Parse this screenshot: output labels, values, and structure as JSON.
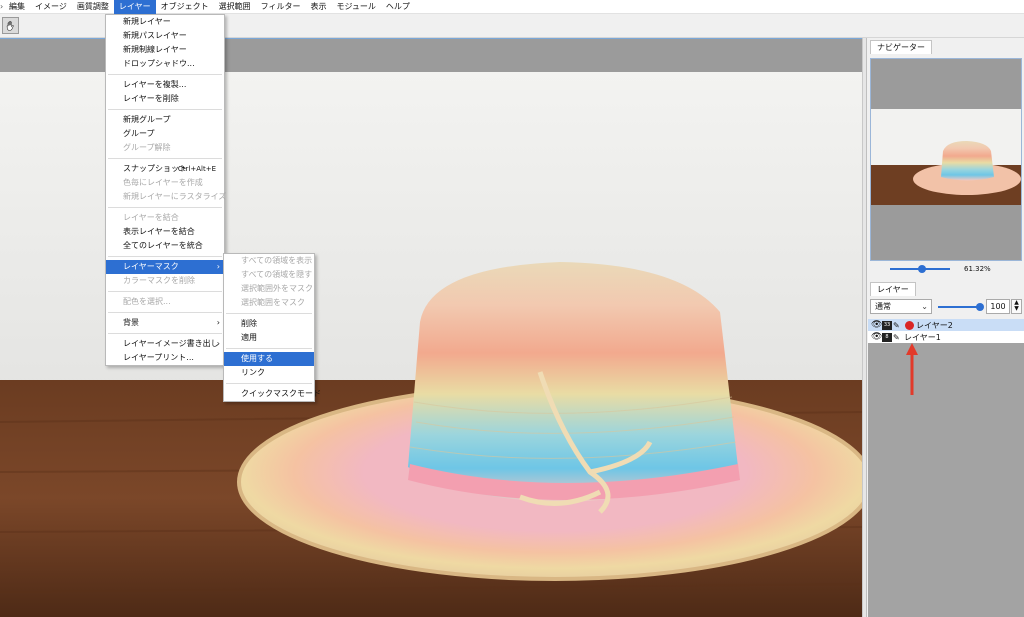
{
  "menubar": {
    "items": [
      "編集",
      "イメージ",
      "画質調整",
      "レイヤー",
      "オブジェクト",
      "選択範囲",
      "フィルター",
      "表示",
      "モジュール",
      "ヘルプ"
    ],
    "active_index": 3
  },
  "toolbar": {
    "tool_icon": "hand-icon"
  },
  "layer_menu": {
    "items": [
      {
        "label": "新規レイヤー",
        "disabled": false
      },
      {
        "label": "新規パスレイヤー",
        "disabled": false
      },
      {
        "label": "新規制線レイヤー",
        "disabled": false
      },
      {
        "label": "ドロップシャドウ...",
        "disabled": false
      },
      {
        "sep": true
      },
      {
        "label": "レイヤーを複製...",
        "disabled": false
      },
      {
        "label": "レイヤーを削除",
        "disabled": false
      },
      {
        "sep": true
      },
      {
        "label": "新規グループ",
        "disabled": false
      },
      {
        "label": "グループ",
        "disabled": false
      },
      {
        "label": "グループ解除",
        "disabled": true
      },
      {
        "sep": true
      },
      {
        "label": "スナップショット",
        "shortcut": "Ctrl+Alt+E",
        "disabled": false
      },
      {
        "label": "色毎にレイヤーを作成",
        "disabled": true
      },
      {
        "label": "新規レイヤーにラスタライズ",
        "disabled": true
      },
      {
        "sep": true
      },
      {
        "label": "レイヤーを結合",
        "disabled": true
      },
      {
        "label": "表示レイヤーを結合",
        "disabled": false
      },
      {
        "label": "全てのレイヤーを統合",
        "disabled": false
      },
      {
        "sep": true
      },
      {
        "label": "レイヤーマスク",
        "submenu": true,
        "highlighted": true
      },
      {
        "label": "カラーマスクを削除",
        "disabled": true
      },
      {
        "sep": true
      },
      {
        "label": "配色を選択...",
        "disabled": true
      },
      {
        "sep": true
      },
      {
        "label": "背景",
        "submenu": true,
        "disabled": false
      },
      {
        "sep": true
      },
      {
        "label": "レイヤーイメージ書き出し",
        "submenu": true,
        "disabled": false
      },
      {
        "label": "レイヤープリント...",
        "disabled": false
      }
    ]
  },
  "mask_submenu": {
    "items": [
      {
        "label": "すべての領域を表示",
        "disabled": true
      },
      {
        "label": "すべての領域を隠す",
        "disabled": true
      },
      {
        "label": "選択範囲外をマスク",
        "disabled": true
      },
      {
        "label": "選択範囲をマスク",
        "disabled": true
      },
      {
        "sep": true
      },
      {
        "label": "削除",
        "disabled": false
      },
      {
        "label": "適用",
        "disabled": false
      },
      {
        "sep": true
      },
      {
        "label": "使用する",
        "highlighted": true
      },
      {
        "label": "リンク",
        "disabled": false
      },
      {
        "sep": true
      },
      {
        "label": "クイックマスクモード",
        "disabled": false
      }
    ]
  },
  "navigator": {
    "tab": "ナビゲーター",
    "zoom": "61.32%",
    "zoom_fraction": 0.54
  },
  "layers_panel": {
    "tab": "レイヤー",
    "blend_mode": "通常",
    "opacity": "100",
    "opacity_fraction": 1.0,
    "layers": [
      {
        "name": "レイヤー2",
        "thumb": "33",
        "has_mask": true,
        "selected": true
      },
      {
        "name": "レイヤー1",
        "thumb": "8",
        "has_mask": false,
        "selected": false
      }
    ]
  },
  "colors": {
    "accent": "#2d6fd2",
    "arrow": "#e23a2a",
    "mask_dot": "#d92626"
  }
}
